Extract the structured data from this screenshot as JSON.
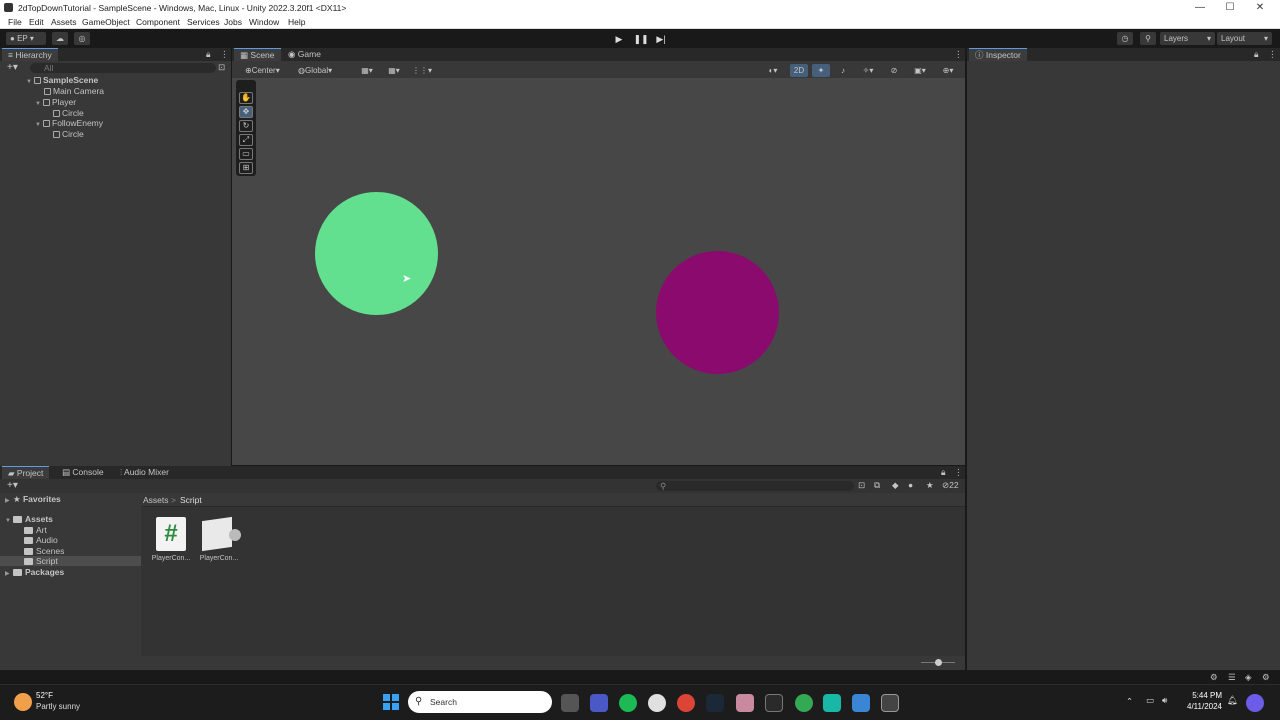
{
  "window": {
    "title": "2dTopDownTutorial - SampleScene - Windows, Mac, Linux - Unity 2022.3.20f1 <DX11>",
    "minimize": "—",
    "maximize": "☐",
    "close": "✕"
  },
  "menu": [
    "File",
    "Edit",
    "Assets",
    "GameObject",
    "Component",
    "Services",
    "Jobs",
    "Window",
    "Help"
  ],
  "toolbar": {
    "account": "EP",
    "layers": "Layers",
    "layout": "Layout"
  },
  "hierarchy": {
    "tab": "Hierarchy",
    "search_placeholder": "All",
    "items": [
      "SampleScene",
      "Main Camera",
      "Player",
      "Circle",
      "FollowEnemy",
      "Circle"
    ]
  },
  "scene": {
    "tabs": [
      "Scene",
      "Game"
    ],
    "pivot": "Center",
    "space": "Global",
    "mode_2d": "2D",
    "colors": {
      "player": "#62e08f",
      "enemy": "#8b0a6e",
      "background": "#474747"
    }
  },
  "inspector": {
    "tab": "Inspector"
  },
  "project": {
    "tabs": [
      "Project",
      "Console",
      "Audio Mixer"
    ],
    "favorites": "Favorites",
    "assets": "Assets",
    "folders": [
      "Art",
      "Audio",
      "Scenes",
      "Script"
    ],
    "packages": "Packages",
    "breadcrumb": [
      "Assets",
      "Script"
    ],
    "files": [
      "PlayerCon...",
      "PlayerCon..."
    ],
    "hidden_count": "22"
  },
  "taskbar": {
    "weather_temp": "52°F",
    "weather_desc": "Partly sunny",
    "search": "Search",
    "time": "5:44 PM",
    "date": "4/11/2024"
  }
}
